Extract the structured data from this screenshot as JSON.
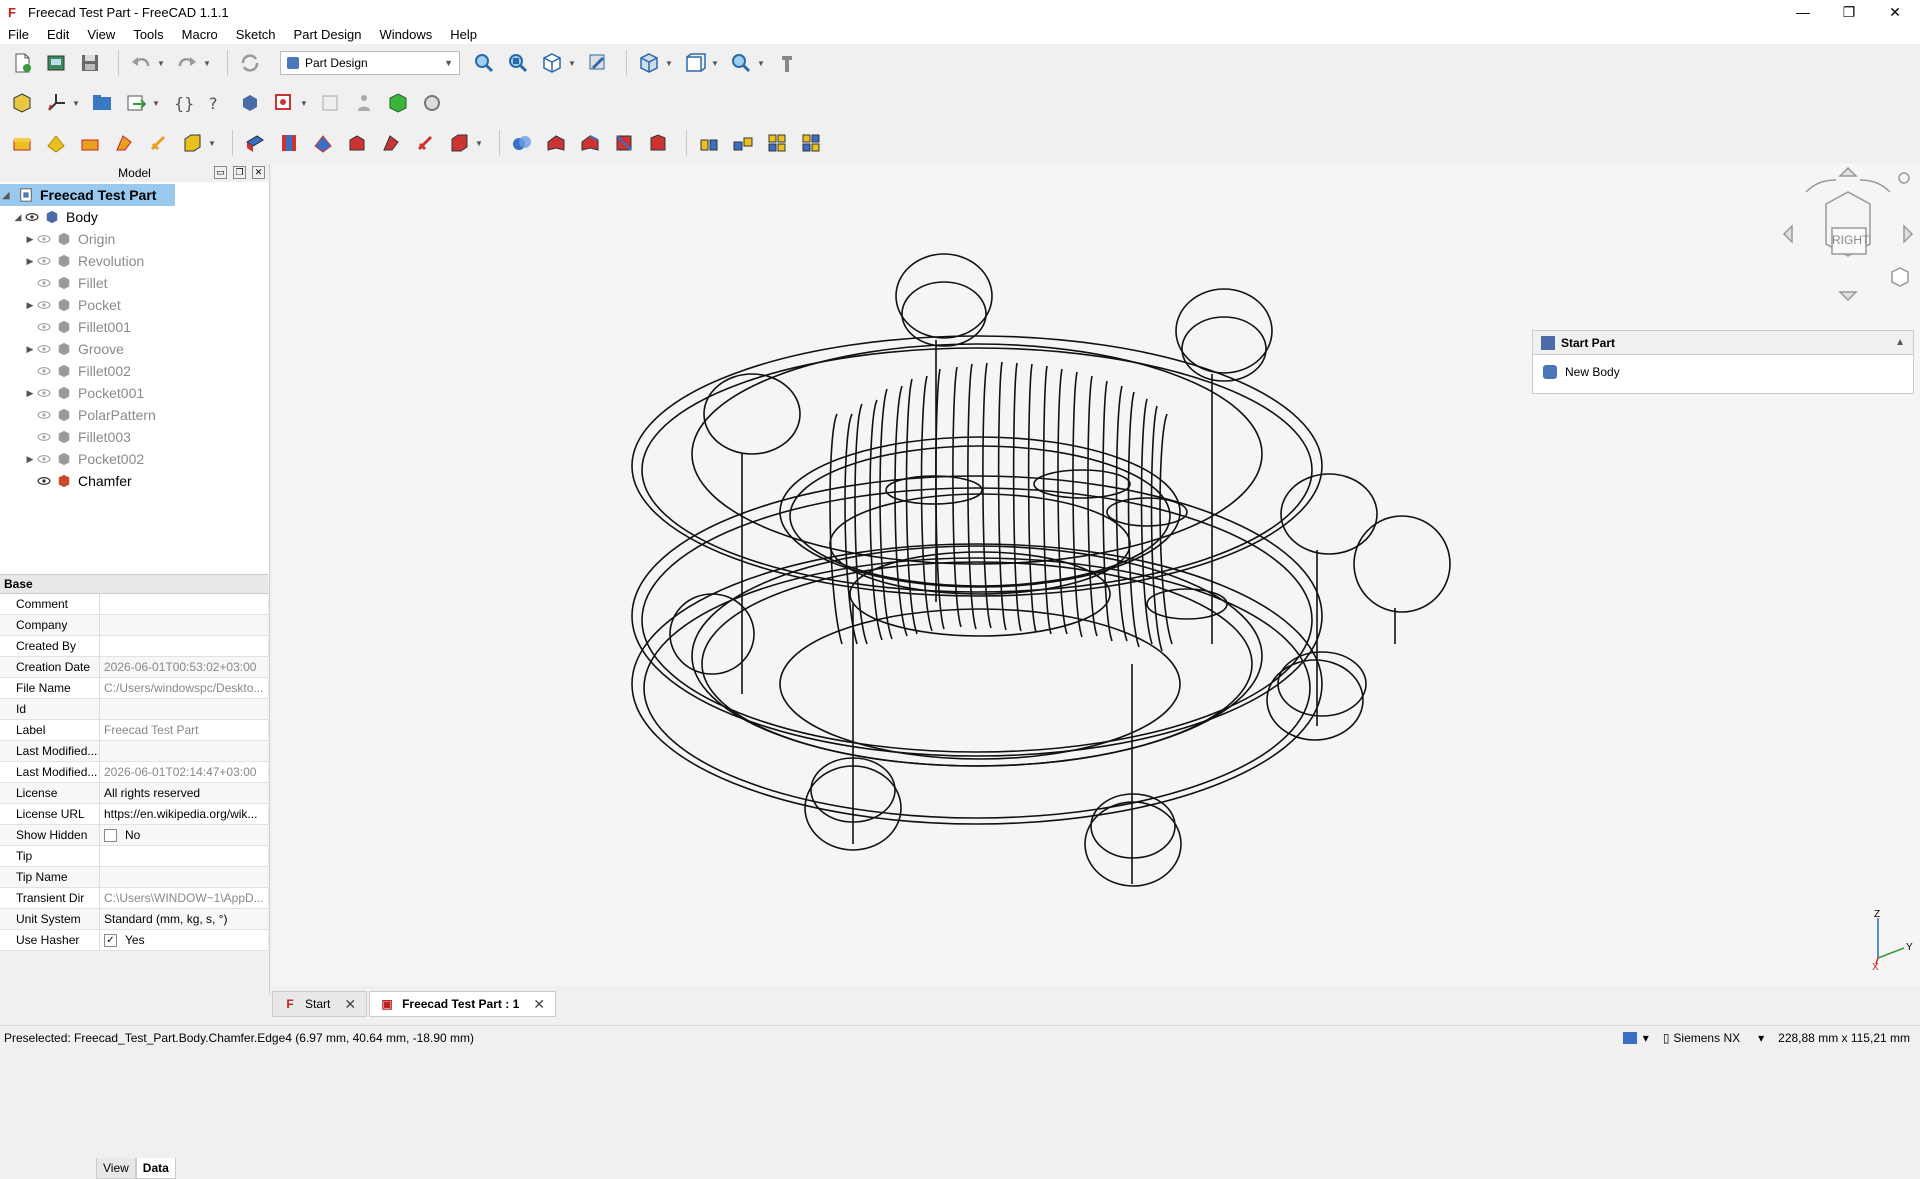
{
  "window": {
    "title": "Freecad Test Part - FreeCAD 1.1.1",
    "controls": {
      "minimize": "—",
      "maximize": "❐",
      "close": "✕"
    }
  },
  "menu": [
    "File",
    "Edit",
    "View",
    "Tools",
    "Macro",
    "Sketch",
    "Part Design",
    "Windows",
    "Help"
  ],
  "toolbar": {
    "workbench": "Part Design"
  },
  "model_panel": {
    "title": "Model",
    "root": "Freecad Test Part",
    "body": "Body",
    "items": [
      {
        "label": "Origin",
        "expandable": true
      },
      {
        "label": "Revolution",
        "expandable": true
      },
      {
        "label": "Fillet",
        "expandable": false
      },
      {
        "label": "Pocket",
        "expandable": true
      },
      {
        "label": "Fillet001",
        "expandable": false
      },
      {
        "label": "Groove",
        "expandable": true
      },
      {
        "label": "Fillet002",
        "expandable": false
      },
      {
        "label": "Pocket001",
        "expandable": true
      },
      {
        "label": "PolarPattern",
        "expandable": false
      },
      {
        "label": "Fillet003",
        "expandable": false
      },
      {
        "label": "Pocket002",
        "expandable": true
      },
      {
        "label": "Chamfer",
        "expandable": false
      }
    ]
  },
  "properties": {
    "group": "Base",
    "rows": [
      {
        "key": "Comment",
        "value": ""
      },
      {
        "key": "Company",
        "value": ""
      },
      {
        "key": "Created By",
        "value": ""
      },
      {
        "key": "Creation Date",
        "value": "2026-06-01T00:53:02+03:00"
      },
      {
        "key": "File Name",
        "value": "C:/Users/windowspc/Deskto..."
      },
      {
        "key": "Id",
        "value": ""
      },
      {
        "key": "Label",
        "value": "Freecad Test Part"
      },
      {
        "key": "Last Modified...",
        "value": ""
      },
      {
        "key": "Last Modified...",
        "value": "2026-06-01T02:14:47+03:00"
      },
      {
        "key": "License",
        "value": "All rights reserved"
      },
      {
        "key": "License URL",
        "value": "https://en.wikipedia.org/wik..."
      },
      {
        "key": "Show Hidden",
        "value": "No"
      },
      {
        "key": "Tip",
        "value": ""
      },
      {
        "key": "Tip Name",
        "value": ""
      },
      {
        "key": "Transient Dir",
        "value": "C:\\Users\\WINDOW~1\\AppD..."
      },
      {
        "key": "Unit System",
        "value": "Standard (mm, kg, s, °)"
      },
      {
        "key": "Use Hasher",
        "value": "Yes"
      }
    ],
    "tabs": [
      "View",
      "Data"
    ],
    "active_tab": "Data"
  },
  "task_panel": {
    "title": "Start Part",
    "item": "New Body"
  },
  "navcube": {
    "face": "RIGHT"
  },
  "doc_tabs": [
    {
      "label": "Start",
      "active": false
    },
    {
      "label": "Freecad Test Part : 1",
      "active": true
    }
  ],
  "axis": {
    "z": "Z",
    "y": "Y",
    "x": "X"
  },
  "status": {
    "message": "Preselected: Freecad_Test_Part.Body.Chamfer.Edge4 (6.97 mm, 40.64 mm, -18.90 mm)",
    "nav_style": "Siemens NX",
    "dimensions": "228,88 mm x 115,21 mm"
  },
  "colors": {
    "selection": "#99c9ef",
    "accent": "#3a6fc4"
  }
}
